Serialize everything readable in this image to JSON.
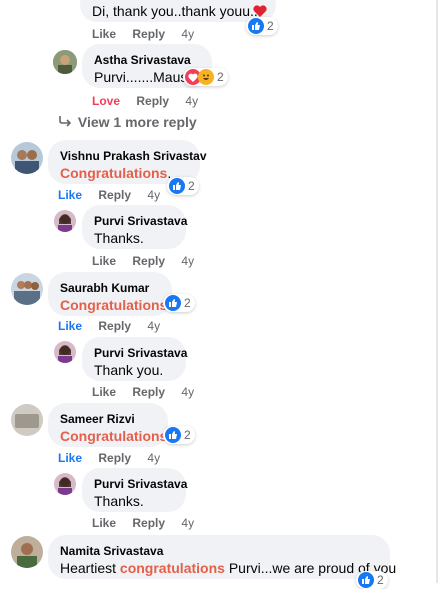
{
  "comments": {
    "top_reply": {
      "text": "Di, thank you..thank youu..",
      "react_count": "2",
      "like": "Like",
      "reply": "Reply",
      "age": "4y"
    },
    "astha": {
      "name": "Astha Srivastava",
      "text": "Purvi.......Mausi",
      "react_count": "2",
      "love": "Love",
      "reply": "Reply",
      "age": "4y"
    },
    "view_more": "View 1 more reply",
    "vishnu": {
      "name": "Vishnu Prakash Srivastav",
      "highlight": "Congratulations",
      "suffix": ".",
      "react_count": "2",
      "like": "Like",
      "reply": "Reply",
      "age": "4y"
    },
    "purvi_1": {
      "name": "Purvi Srivastava",
      "text": "Thanks.",
      "like": "Like",
      "reply": "Reply",
      "age": "4y"
    },
    "saurabh": {
      "name": "Saurabh Kumar",
      "highlight": "Congratulations",
      "react_count": "2",
      "like": "Like",
      "reply": "Reply",
      "age": "4y"
    },
    "purvi_2": {
      "name": "Purvi Srivastava",
      "text": "Thank you.",
      "like": "Like",
      "reply": "Reply",
      "age": "4y"
    },
    "sameer": {
      "name": "Sameer Rizvi",
      "highlight": "Congratulations",
      "react_count": "2",
      "like": "Like",
      "reply": "Reply",
      "age": "4y"
    },
    "purvi_3": {
      "name": "Purvi Srivastava",
      "text": "Thanks.",
      "like": "Like",
      "reply": "Reply",
      "age": "4y"
    },
    "namita": {
      "name": "Namita Srivastava",
      "prefix": "Heartiest ",
      "highlight": "congratulations",
      "suffix": " Purvi...we are proud of you",
      "react_count": "2"
    }
  },
  "colors": {
    "like_blue": "#1877f2",
    "love_red": "#f33e58",
    "highlight": "#e4604a",
    "bubble": "#f0f2f5",
    "meta_gray": "#65676b"
  },
  "icons": {
    "like": "thumbs-up-icon",
    "love": "heart-icon",
    "haha": "haha-icon",
    "reply_arrow": "reply-arrow-icon"
  }
}
